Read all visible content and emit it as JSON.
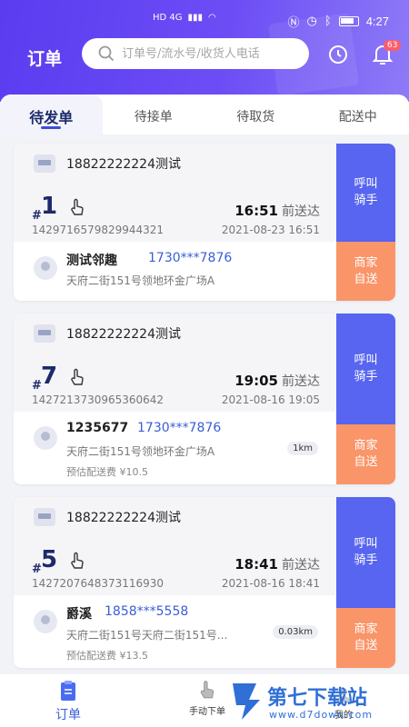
{
  "status": {
    "time": "4:27",
    "network": "HD 4G"
  },
  "header": {
    "title": "订单",
    "search_placeholder": "订单号/流水号/收货人电话",
    "notification_count": "63"
  },
  "tabs": [
    {
      "label": "待发单",
      "active": true
    },
    {
      "label": "待接单",
      "active": false
    },
    {
      "label": "待取货",
      "active": false
    },
    {
      "label": "配送中",
      "active": false
    }
  ],
  "orders": [
    {
      "store": "18822222224测试",
      "number": "1",
      "time": "16:51",
      "eta_label": "前送达",
      "order_no": "1429716579829944321",
      "date": "2021-08-23 16:51",
      "customer": "测试邻趣",
      "phone": "1730***7876",
      "address": "天府二街151号领地环金广场A",
      "distance": "",
      "fee": "",
      "call_label": "呼叫\n骑手",
      "self_label": "商家\n自送"
    },
    {
      "store": "18822222224测试",
      "number": "7",
      "time": "19:05",
      "eta_label": "前送达",
      "order_no": "1427213730965360642",
      "date": "2021-08-16 19:05",
      "customer": "1235677",
      "phone": "1730***7876",
      "address": "天府二街151号领地环金广场A",
      "distance": "1km",
      "fee": "预估配送费 ¥10.5",
      "call_label": "呼叫\n骑手",
      "self_label": "商家\n自送"
    },
    {
      "store": "18822222224测试",
      "number": "5",
      "time": "18:41",
      "eta_label": "前送达",
      "order_no": "1427207648373116930",
      "date": "2021-08-16 18:41",
      "customer": "爵溪",
      "phone": "1858***5558",
      "address": "天府二街151号天府二街151号...",
      "distance": "0.03km",
      "fee": "预估配送费 ¥13.5",
      "call_label": "呼叫\n骑手",
      "self_label": "商家\n自送"
    }
  ],
  "bottom_nav": [
    {
      "label": "订单",
      "active": true
    },
    {
      "label": "手动下单",
      "active": false
    },
    {
      "label": "我的",
      "active": false
    }
  ],
  "watermark": {
    "text": "第七下载站",
    "url": "www.d7down.com"
  },
  "colors": {
    "accent": "#5765f0",
    "self_send": "#f99569",
    "header": "#5b3cf0"
  }
}
